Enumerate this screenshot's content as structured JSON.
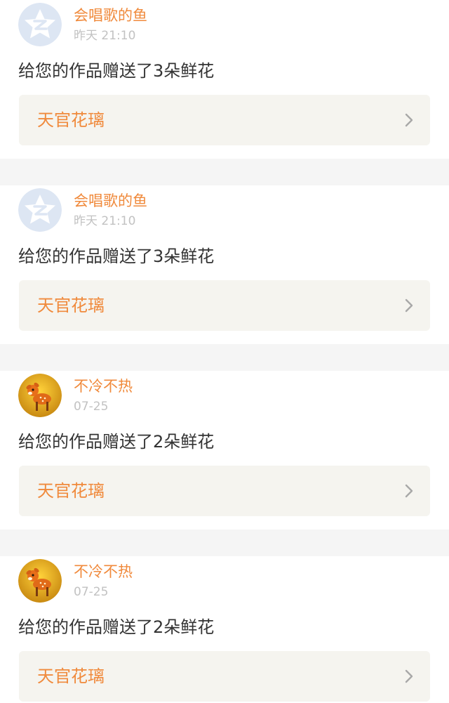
{
  "notifications": [
    {
      "username": "会唱歌的鱼",
      "time": "昨天 21:10",
      "message": "给您的作品赠送了3朵鲜花",
      "work_title": "天官花璃",
      "avatar_icon": "qzone-star-icon"
    },
    {
      "username": "会唱歌的鱼",
      "time": "昨天 21:10",
      "message": "给您的作品赠送了3朵鲜花",
      "work_title": "天官花璃",
      "avatar_icon": "qzone-star-icon"
    },
    {
      "username": "不冷不热",
      "time": "07-25",
      "message": "给您的作品赠送了2朵鲜花",
      "work_title": "天官花璃",
      "avatar_icon": "fawn-icon"
    },
    {
      "username": "不冷不热",
      "time": "07-25",
      "message": "给您的作品赠送了2朵鲜花",
      "work_title": "天官花璃",
      "avatar_icon": "fawn-icon"
    }
  ],
  "colors": {
    "accent": "#f08a3c",
    "time": "#c2c2c2",
    "message": "#333333",
    "link_bg": "#f5f4ef",
    "separator": "#f5f5f5"
  }
}
